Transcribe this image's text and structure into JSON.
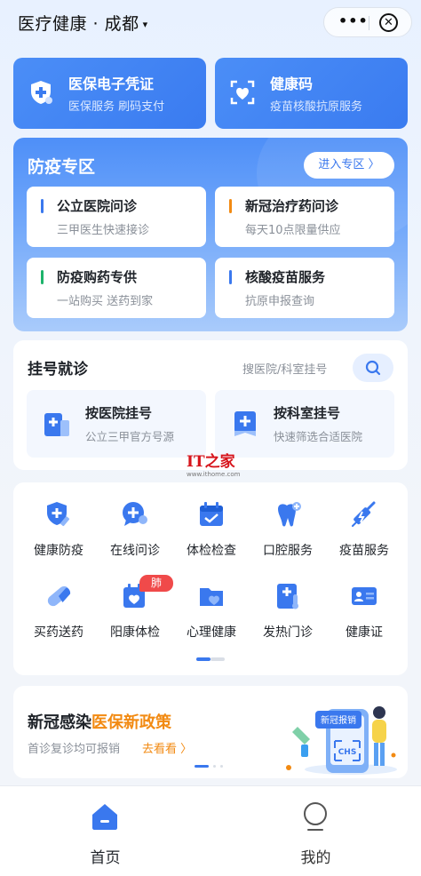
{
  "header": {
    "title": "医疗健康 · 成都",
    "caret": "▾",
    "more": "•••",
    "close": "✕"
  },
  "top_cards": [
    {
      "title": "医保电子凭证",
      "subtitle": "医保服务 刷码支付",
      "icon": "medical-insurance-shield-icon"
    },
    {
      "title": "健康码",
      "subtitle": "疫苗核酸抗原服务",
      "icon": "health-code-scan-icon"
    }
  ],
  "epidemic": {
    "title": "防疫专区",
    "enter_label": "进入专区 〉",
    "items": [
      {
        "title": "公立医院问诊",
        "subtitle": "三甲医生快速接诊",
        "accent": "#3a78ee"
      },
      {
        "title": "新冠治疗药问诊",
        "subtitle": "每天10点限量供应",
        "accent": "#f28a12"
      },
      {
        "title": "防疫购药专供",
        "subtitle": "一站购买 送药到家",
        "accent": "#1db36b"
      },
      {
        "title": "核酸疫苗服务",
        "subtitle": "抗原申报查询",
        "accent": "#3a78ee"
      }
    ]
  },
  "registration": {
    "title": "挂号就诊",
    "search_hint": "搜医院/科室挂号",
    "items": [
      {
        "title": "按医院挂号",
        "subtitle": "公立三甲官方号源",
        "icon": "hospital-building-icon"
      },
      {
        "title": "按科室挂号",
        "subtitle": "快速筛选合适医院",
        "icon": "department-clipboard-icon"
      }
    ]
  },
  "watermark": {
    "logo": "IT之家",
    "url": "www.ithome.com"
  },
  "services": {
    "items": [
      {
        "label": "健康防疫",
        "icon": "shield-syringe-icon"
      },
      {
        "label": "在线问诊",
        "icon": "chat-plus-icon"
      },
      {
        "label": "体检检查",
        "icon": "calendar-check-icon"
      },
      {
        "label": "口腔服务",
        "icon": "tooth-icon"
      },
      {
        "label": "疫苗服务",
        "icon": "vaccine-syringe-icon"
      },
      {
        "label": "买药送药",
        "icon": "capsule-pill-icon"
      },
      {
        "label": "阳康体检",
        "icon": "heart-calendar-icon",
        "badge": "肺CT"
      },
      {
        "label": "心理健康",
        "icon": "heart-folder-icon"
      },
      {
        "label": "发热门诊",
        "icon": "thermometer-doc-icon"
      },
      {
        "label": "健康证",
        "icon": "id-card-icon"
      }
    ],
    "page": 1,
    "pages": 2
  },
  "banner": {
    "title_prefix": "新冠感染",
    "title_highlight": "医保新政策",
    "subtitle": "首诊复诊均可报销",
    "link": "去看看 〉",
    "sign_text": "新冠报销",
    "card_text": "CHS",
    "page": 1,
    "pages": 3
  },
  "tabbar": {
    "items": [
      {
        "label": "首页",
        "icon": "home-icon",
        "active": true
      },
      {
        "label": "我的",
        "icon": "profile-icon",
        "active": false
      }
    ]
  },
  "colors": {
    "primary": "#3a78ee",
    "orange": "#f28a12",
    "green": "#1db36b",
    "badge_red": "#f04a4a"
  }
}
